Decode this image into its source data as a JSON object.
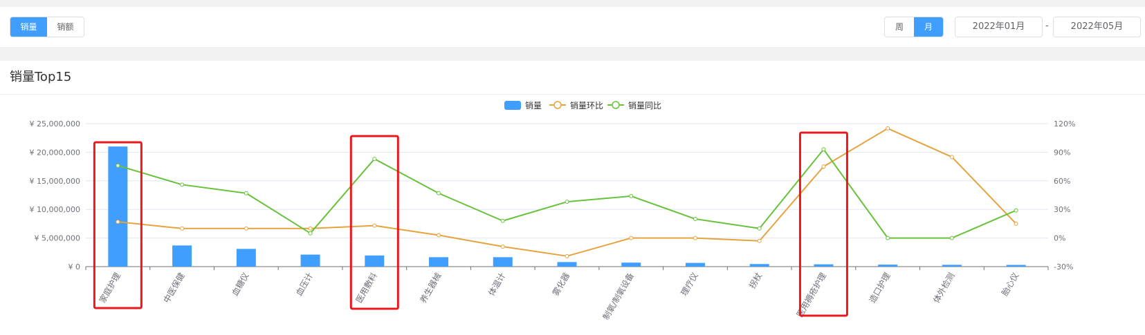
{
  "toolbar": {
    "metric_tabs": [
      {
        "label": "销量",
        "active": true
      },
      {
        "label": "销额",
        "active": false
      }
    ],
    "period_tabs": [
      {
        "label": "周",
        "active": false
      },
      {
        "label": "月",
        "active": true
      }
    ],
    "date_start": "2022年01月",
    "date_separator": "-",
    "date_end": "2022年05月"
  },
  "card": {
    "title": "销量Top15"
  },
  "colors": {
    "bar": "#409eff",
    "mom": "#e6a23c",
    "yoy": "#67c23a",
    "highlight": "#e8181c"
  },
  "chart_data": {
    "type": "bar",
    "categories": [
      "家庭护理",
      "中医保健",
      "血糖仪",
      "血压计",
      "医用敷料",
      "养生器械",
      "体温计",
      "雾化器",
      "制氧/制氧设备",
      "理疗仪",
      "拐杖",
      "医用褥疮护理",
      "造口护理",
      "体外检测",
      "胎心仪"
    ],
    "series": [
      {
        "name": "销量",
        "type": "bar",
        "axis": "left",
        "values": [
          21000000,
          3700000,
          3100000,
          2100000,
          1950000,
          1650000,
          1650000,
          800000,
          700000,
          650000,
          450000,
          400000,
          350000,
          320000,
          300000
        ]
      },
      {
        "name": "销量环比",
        "type": "line",
        "axis": "right",
        "values": [
          17,
          10,
          10,
          10,
          13,
          3,
          -9,
          -19,
          0,
          0,
          -3,
          75,
          115,
          85,
          15
        ]
      },
      {
        "name": "销量同比",
        "type": "line",
        "axis": "right",
        "values": [
          76,
          56,
          47,
          5,
          83,
          47,
          18,
          38,
          44,
          20,
          10,
          93,
          0,
          0,
          29
        ]
      }
    ],
    "left_axis": {
      "min": 0,
      "max": 25000000,
      "step": 5000000,
      "tick_labels": [
        "¥ 0",
        "¥ 5,000,000",
        "¥ 10,000,000",
        "¥ 15,000,000",
        "¥ 20,000,000",
        "¥ 25,000,000"
      ]
    },
    "right_axis": {
      "min": -30,
      "max": 120,
      "step": 30,
      "tick_labels": [
        "-30%",
        "0%",
        "30%",
        "60%",
        "90%",
        "120%"
      ]
    },
    "legend_position": "top-center",
    "grid": true,
    "highlighted_categories": [
      "家庭护理",
      "医用敷料",
      "医用褥疮护理"
    ]
  }
}
